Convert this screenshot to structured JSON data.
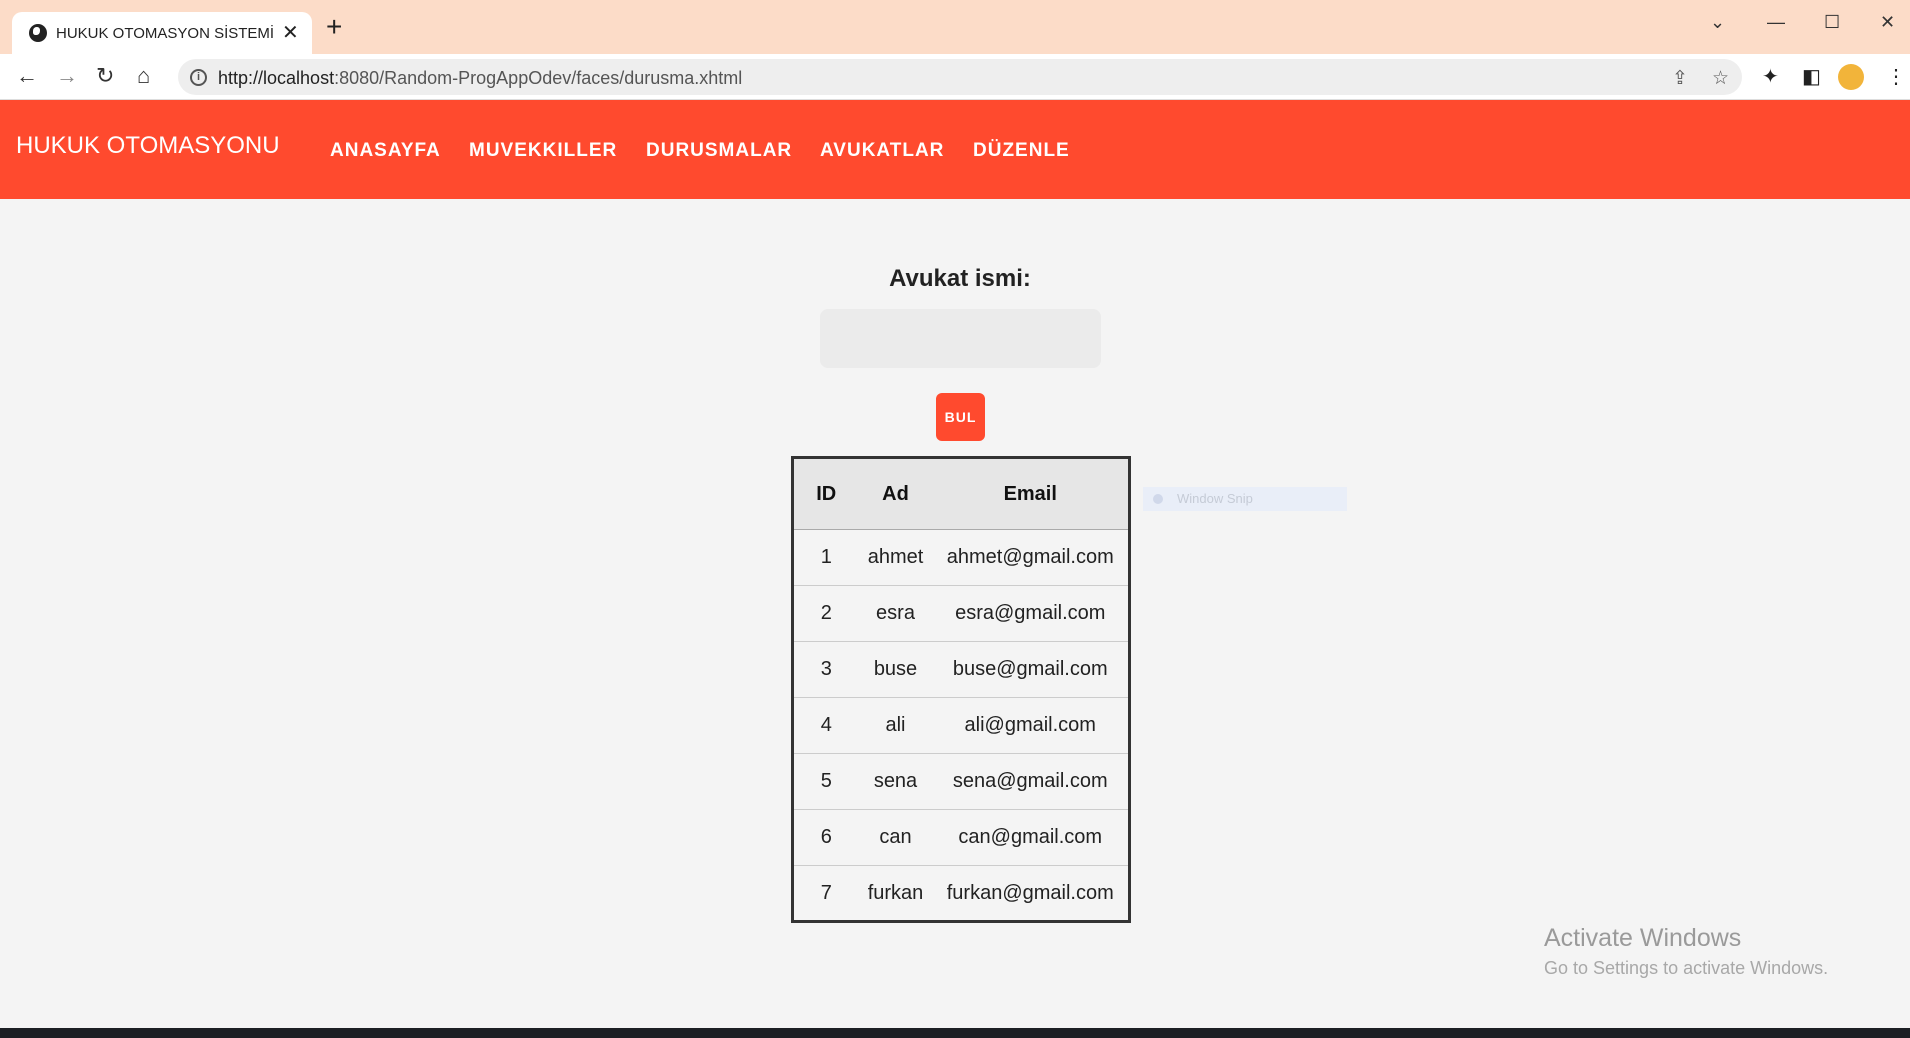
{
  "browser": {
    "tab_title": "HUKUK OTOMASYON SİSTEMİ",
    "url_host": "http://localhost",
    "url_rest": ":8080/Random-ProgAppOdev/faces/durusma.xhtml"
  },
  "navbar": {
    "brand": "HUKUK OTOMASYONU",
    "items": [
      "ANASAYFA",
      "MUVEKKILLER",
      "DURUSMALAR",
      "AVUKATLAR",
      "DÜZENLE"
    ]
  },
  "search": {
    "label": "Avukat ismi:",
    "value": "",
    "button": "BUL"
  },
  "table": {
    "headers": [
      "ID",
      "Ad",
      "Email"
    ],
    "rows": [
      [
        "1",
        "ahmet",
        "ahmet@gmail.com"
      ],
      [
        "2",
        "esra",
        "esra@gmail.com"
      ],
      [
        "3",
        "buse",
        "buse@gmail.com"
      ],
      [
        "4",
        "ali",
        "ali@gmail.com"
      ],
      [
        "5",
        "sena",
        "sena@gmail.com"
      ],
      [
        "6",
        "can",
        "can@gmail.com"
      ],
      [
        "7",
        "furkan",
        "furkan@gmail.com"
      ]
    ]
  },
  "overlay": {
    "snip_label": "Window Snip",
    "activate_title": "Activate Windows",
    "activate_sub": "Go to Settings to activate Windows."
  },
  "colors": {
    "accent": "#ff4a2e",
    "tabbar": "#fcdcc8"
  },
  "icons": {
    "tab": "globe-icon",
    "window": [
      "chevron-down-icon",
      "minimize-icon",
      "maximize-icon",
      "close-icon"
    ],
    "nav": [
      "back-icon",
      "forward-icon",
      "reload-icon",
      "home-icon"
    ],
    "toolbar": [
      "share-icon",
      "star-icon",
      "extensions-icon",
      "sidepanel-icon",
      "menu-icon"
    ]
  }
}
